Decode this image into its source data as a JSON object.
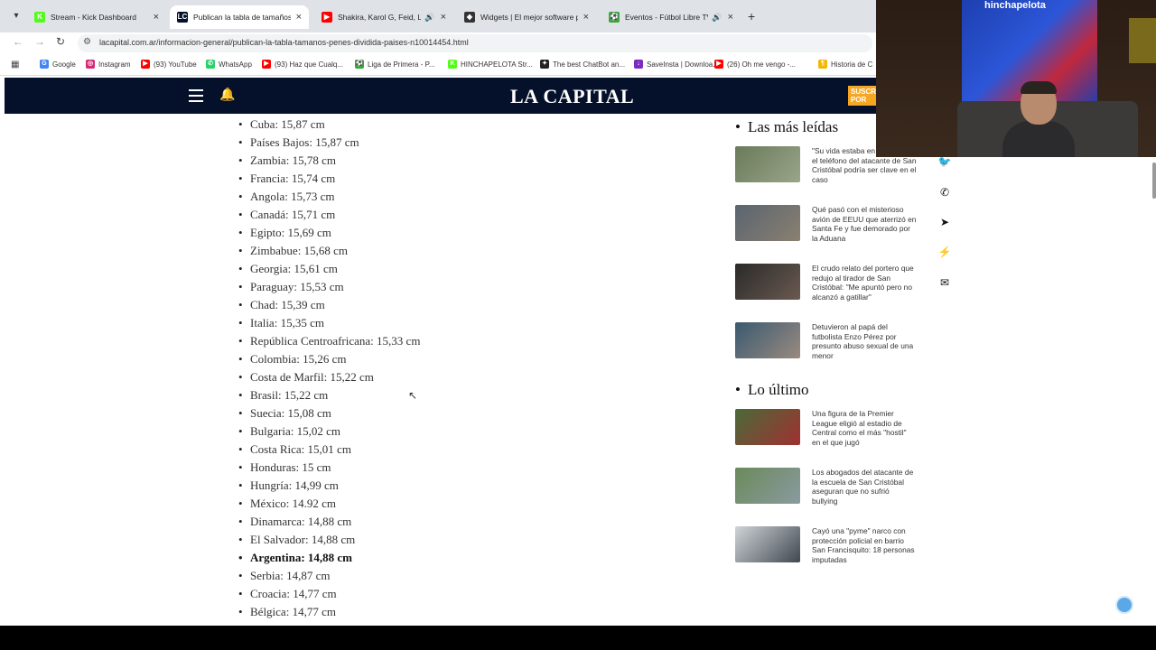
{
  "browser": {
    "tabs": [
      {
        "title": "Stream - Kick Dashboard",
        "favicon": "kick-icon",
        "color": "#53fc18",
        "glyph": "K",
        "audio": false,
        "active": false
      },
      {
        "title": "Publican la tabla de tamaños d",
        "favicon": "lacapital-icon",
        "color": "#05112b",
        "glyph": "LC",
        "audio": false,
        "active": true
      },
      {
        "title": "Shakira, Karol G, Feid, Luis",
        "favicon": "youtube-icon",
        "color": "#ff0000",
        "glyph": "▶",
        "audio": true,
        "active": false
      },
      {
        "title": "Widgets | El mejor software pa",
        "favicon": "widgets-icon",
        "color": "#333333",
        "glyph": "◆",
        "audio": false,
        "active": false
      },
      {
        "title": "Eventos - Fútbol Libre TV",
        "favicon": "futbol-icon",
        "color": "#3aa63a",
        "glyph": "⚽",
        "audio": true,
        "active": false
      }
    ],
    "url": "lacapital.com.ar/informacion-general/publican-la-tabla-tamanos-penes-dividida-paises-n10014454.html",
    "bookmarks": [
      {
        "label": "Google",
        "color": "#4285f4",
        "glyph": "G"
      },
      {
        "label": "Instagram",
        "color": "#d62976",
        "glyph": "◎"
      },
      {
        "label": "(93) YouTube",
        "color": "#ff0000",
        "glyph": "▶"
      },
      {
        "label": "WhatsApp",
        "color": "#25d366",
        "glyph": "✆"
      },
      {
        "label": "(93) Haz que Cualq...",
        "color": "#ff0000",
        "glyph": "▶"
      },
      {
        "label": "Liga de Primera - P...",
        "color": "#3aa63a",
        "glyph": "⚽"
      },
      {
        "label": "HINCHAPELOTA Str...",
        "color": "#53fc18",
        "glyph": "K"
      },
      {
        "label": "The best ChatBot an...",
        "color": "#222222",
        "glyph": "✦"
      },
      {
        "label": "SaveInsta | Downloa...",
        "color": "#7b2cbf",
        "glyph": "↓"
      },
      {
        "label": "(26) Oh me vengo -...",
        "color": "#ff0000",
        "glyph": "▶"
      },
      {
        "label": "Historia de C",
        "color": "#f2b705",
        "glyph": "¶"
      }
    ]
  },
  "site": {
    "logo": "LA CAPITAL",
    "subscribe": "SUSCRI POR"
  },
  "article": {
    "items": [
      {
        "text": "Cuba: 15,87 cm",
        "bold": false
      },
      {
        "text": "Países Bajos: 15,87 cm",
        "bold": false
      },
      {
        "text": "Zambia: 15,78 cm",
        "bold": false
      },
      {
        "text": "Francia: 15,74 cm",
        "bold": false
      },
      {
        "text": "Angola: 15,73 cm",
        "bold": false
      },
      {
        "text": "Canadá: 15,71 cm",
        "bold": false
      },
      {
        "text": "Egipto: 15,69 cm",
        "bold": false
      },
      {
        "text": "Zimbabue: 15,68 cm",
        "bold": false
      },
      {
        "text": "Georgia: 15,61 cm",
        "bold": false
      },
      {
        "text": "Paraguay: 15,53 cm",
        "bold": false
      },
      {
        "text": "Chad: 15,39 cm",
        "bold": false
      },
      {
        "text": "Italia: 15,35 cm",
        "bold": false
      },
      {
        "text": "República Centroafricana: 15,33 cm",
        "bold": false
      },
      {
        "text": "Colombia: 15,26 cm",
        "bold": false
      },
      {
        "text": "Costa de Marfil: 15,22 cm",
        "bold": false
      },
      {
        "text": "Brasil: 15,22 cm",
        "bold": false
      },
      {
        "text": "Suecia: 15,08 cm",
        "bold": false
      },
      {
        "text": "Bulgaria: 15,02 cm",
        "bold": false
      },
      {
        "text": "Costa Rica: 15,01 cm",
        "bold": false
      },
      {
        "text": "Honduras: 15 cm",
        "bold": false
      },
      {
        "text": "Hungría: 14,99 cm",
        "bold": false
      },
      {
        "text": "México: 14.92 cm",
        "bold": false
      },
      {
        "text": "Dinamarca: 14,88 cm",
        "bold": false
      },
      {
        "text": "El Salvador: 14,88 cm",
        "bold": false
      },
      {
        "text": "Argentina: 14,88 cm",
        "bold": true
      },
      {
        "text": "Serbia: 14,87 cm",
        "bold": false
      },
      {
        "text": "Croacia: 14,77 cm",
        "bold": false
      },
      {
        "text": "Bélgica: 14,77 cm",
        "bold": false
      }
    ]
  },
  "sidebar": {
    "most_read_title": "Las más leídas",
    "most_read": [
      {
        "text": "\"Su vida estaba en su celular\": el teléfono del atacante de San Cristóbal podría ser clave en el caso",
        "thumb": [
          "#6a7a5a",
          "#9aa58a"
        ]
      },
      {
        "text": "Qué pasó con el misterioso avión de EEUU que aterrizó en Santa Fe y fue demorado por la Aduana",
        "thumb": [
          "#5a6470",
          "#8a8070"
        ]
      },
      {
        "text": "El crudo relato del portero que redujo al tirador de San Cristóbal: \"Me apuntó pero no alcanzó a gatillar\"",
        "thumb": [
          "#2a2a2a",
          "#6a5a50"
        ]
      },
      {
        "text": "Detuvieron al papá del futbolista Enzo Pérez por presunto abuso sexual de una menor",
        "thumb": [
          "#3a5a70",
          "#9a8a80"
        ]
      }
    ],
    "latest_title": "Lo último",
    "latest": [
      {
        "text": "Una figura de la Premier League eligió al estadio de Central como el más \"hostil\" en el que jugó",
        "thumb": [
          "#4a6a3a",
          "#a03030"
        ]
      },
      {
        "text": "Los abogados del atacante de la escuela de San Cristóbal aseguran que no sufrió bullying",
        "thumb": [
          "#6a8a5a",
          "#8a9aa0"
        ]
      },
      {
        "text": "Cayó una \"pyme\" narco con protección policial en barrio San Francisquito: 18 personas imputadas",
        "thumb": [
          "#d0d4d8",
          "#404850"
        ]
      }
    ]
  },
  "share": [
    "twitter-icon",
    "whatsapp-icon",
    "telegram-icon",
    "messenger-icon",
    "email-icon"
  ],
  "webcam": {
    "banner_text": "hinchapelota"
  }
}
